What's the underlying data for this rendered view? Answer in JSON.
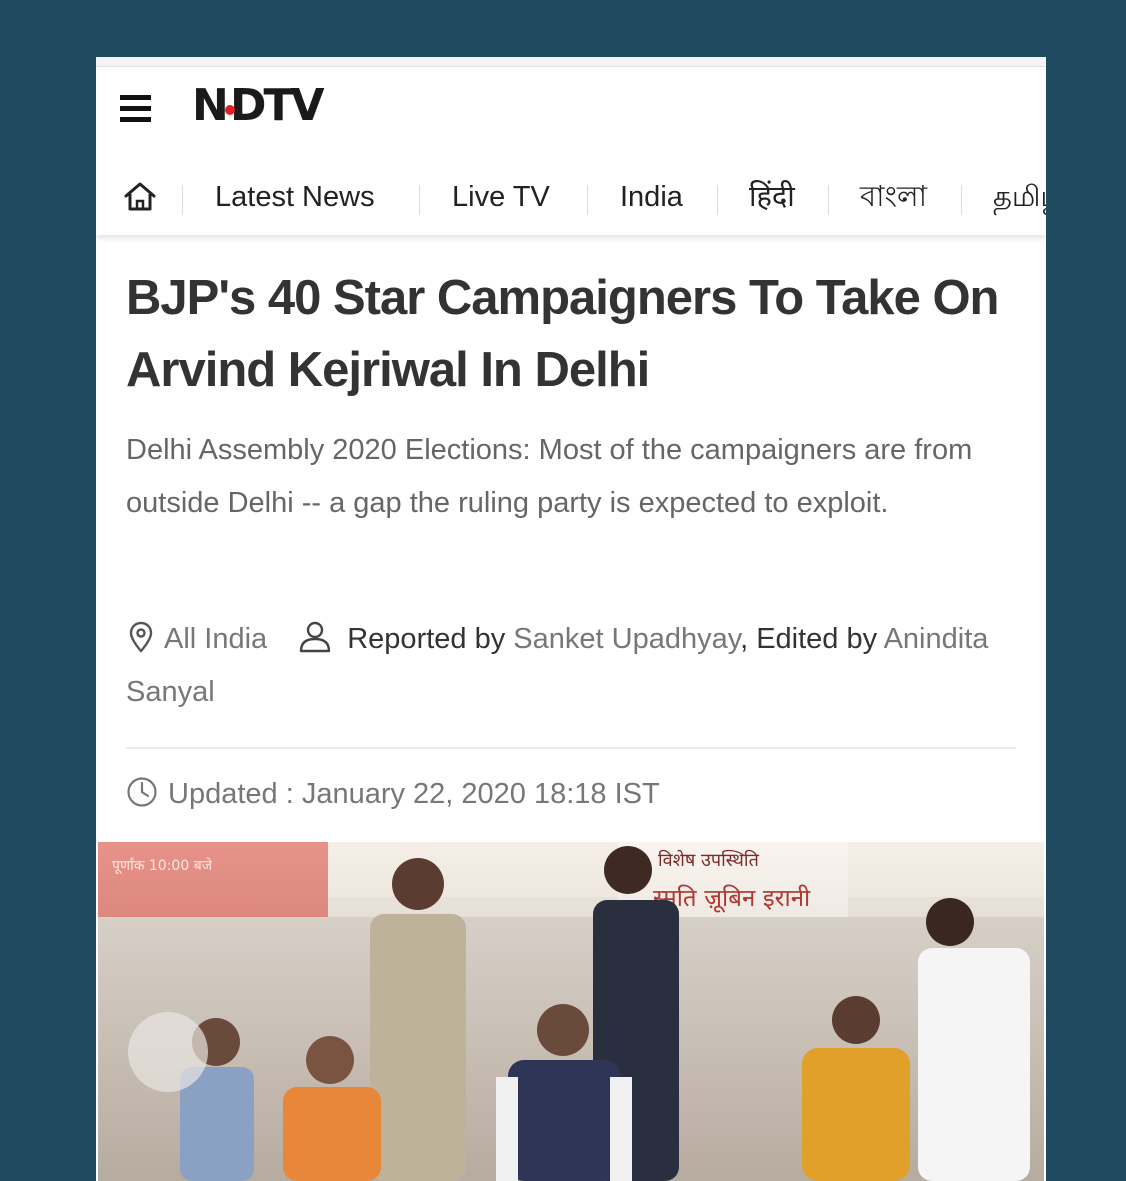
{
  "header": {
    "logo_text": "NDTV",
    "logo_dot_color": "#e21e26"
  },
  "nav": {
    "items": [
      {
        "label": "Latest News"
      },
      {
        "label": "Live TV"
      },
      {
        "label": "India"
      },
      {
        "label": "हिंदी"
      },
      {
        "label": "বাংলা"
      },
      {
        "label": "தமிழ்"
      }
    ]
  },
  "article": {
    "headline": "BJP's 40 Star Campaigners To Take On Arvind Kejriwal In Delhi",
    "summary": "Delhi Assembly 2020 Elections: Most of the campaigners are from outside Delhi -- a gap the ruling party is expected to exploit.",
    "location": "All India",
    "reported_by_label": "Reported by",
    "reporter": "Sanket Upadhyay",
    "edited_by_label": ", Edited by",
    "editor": "Anindita Sanyal",
    "updated": "Updated : January 22, 2020 18:18 IST"
  },
  "photo": {
    "banner_left": "पूर्णांक 10:00 बजे",
    "banner_center_top": "विशेष उपस्थिति",
    "banner_center_name": "स्मृति ज़ूबिन इरानी"
  }
}
